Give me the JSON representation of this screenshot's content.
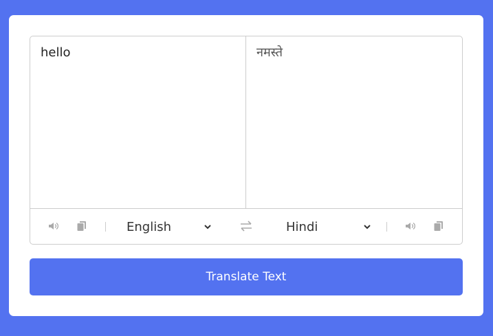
{
  "input": {
    "from_text": "hello",
    "to_text": "नमस्ते"
  },
  "controls": {
    "from_language": "English",
    "to_language": "Hindi",
    "icons": [
      "volume-icon",
      "copy-icon",
      "swap-icon",
      "chevron-down-icon"
    ]
  },
  "button": {
    "translate_label": "Translate Text"
  },
  "colors": {
    "background": "#5372F0",
    "card": "#ffffff",
    "button": "#5372F0",
    "icon": "#aaaaaa",
    "border": "#cccccc"
  }
}
